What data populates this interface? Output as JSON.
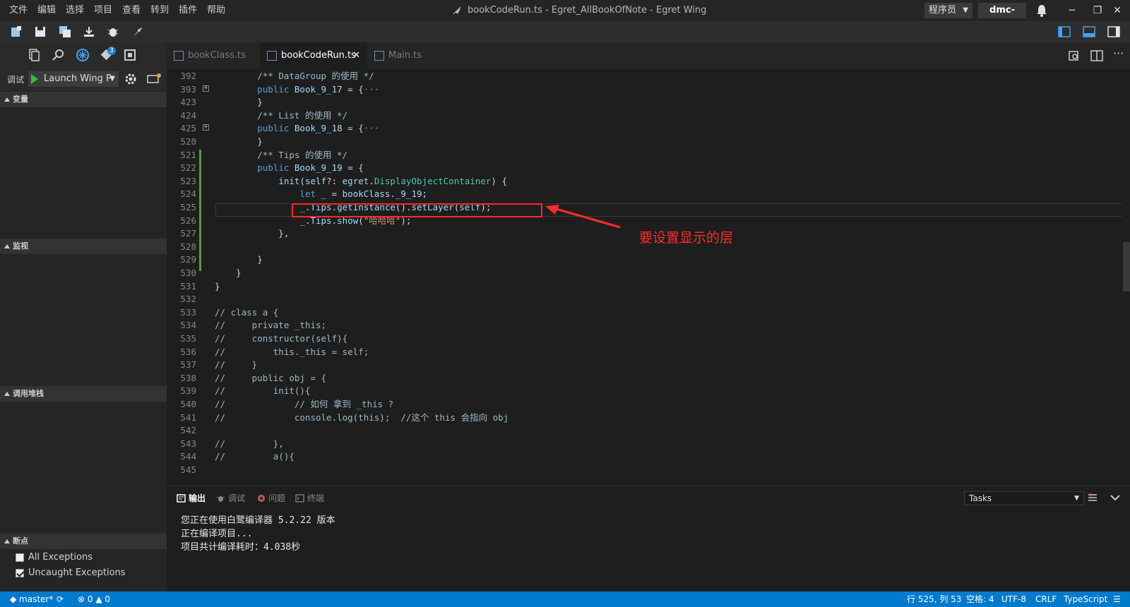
{
  "menu": [
    "文件",
    "编辑",
    "选择",
    "项目",
    "查看",
    "转到",
    "插件",
    "帮助"
  ],
  "window_title": "bookCodeRun.ts - Egret_AllBookOfNote - Egret Wing",
  "role": "程序员",
  "user": "dmc-nero",
  "git_badge": "3",
  "debug": {
    "label": "调试",
    "launch": "Launch Wing P"
  },
  "sections": {
    "variables": "变量",
    "watch": "监视",
    "callstack": "调用堆栈",
    "breakpoints": "断点"
  },
  "breakpoints": [
    {
      "label": "All Exceptions",
      "checked": false
    },
    {
      "label": "Uncaught Exceptions",
      "checked": true
    }
  ],
  "tabs": [
    {
      "label": "bookClass.ts",
      "active": false
    },
    {
      "label": "bookCodeRun.ts",
      "active": true
    },
    {
      "label": "Main.ts",
      "active": false
    }
  ],
  "code_lines": [
    {
      "n": "392",
      "fold": false,
      "html": "        <span class='cm2'>/** DataGroup 的使用 */</span>"
    },
    {
      "n": "393",
      "fold": true,
      "html": "        <span class='kw'>public</span> <span class='id'>Book_9_17</span> = {<span class='gray'>···</span>"
    },
    {
      "n": "423",
      "fold": false,
      "html": "        }"
    },
    {
      "n": "424",
      "fold": false,
      "html": "        <span class='cm2'>/** List 的使用 */</span>"
    },
    {
      "n": "425",
      "fold": true,
      "html": "        <span class='kw'>public</span> <span class='id'>Book_9_18</span> = {<span class='gray'>···</span>"
    },
    {
      "n": "520",
      "fold": false,
      "html": "        }"
    },
    {
      "n": "521",
      "fold": false,
      "html": "        <span class='cm2'>/** Tips 的使用 */</span>"
    },
    {
      "n": "522",
      "fold": false,
      "html": "        <span class='kw'>public</span> <span class='id'>Book_9_19</span> = {"
    },
    {
      "n": "523",
      "fold": false,
      "html": "            <span class='id'>init</span>(<span class='id'>self</span>?: <span class='id'>egret</span>.<span class='ty'>DisplayObjectContainer</span>) {"
    },
    {
      "n": "524",
      "fold": false,
      "html": "                <span class='kw'>let</span> <span class='id'>_</span> = <span class='id'>bookClass</span>.<span class='id'>_9_19</span>;"
    },
    {
      "n": "525",
      "fold": false,
      "html": "                <span class='id'>_</span>.<span class='id'>Tips</span>.<span class='id'>getInstance</span>().<span class='id'>setLayer</span>(<span class='id'>self</span>);"
    },
    {
      "n": "526",
      "fold": false,
      "html": "                <span class='id'>_</span>.<span class='id'>Tips</span>.<span class='id'>show</span>(<span class='str'>\"哈哈哈\"</span>);"
    },
    {
      "n": "527",
      "fold": false,
      "html": "            },"
    },
    {
      "n": "528",
      "fold": false,
      "html": ""
    },
    {
      "n": "529",
      "fold": false,
      "html": "        }"
    },
    {
      "n": "530",
      "fold": false,
      "html": "    }"
    },
    {
      "n": "531",
      "fold": false,
      "html": "}"
    },
    {
      "n": "532",
      "fold": false,
      "html": ""
    },
    {
      "n": "533",
      "fold": false,
      "html": "<span class='cm2'>// class a {</span>"
    },
    {
      "n": "534",
      "fold": false,
      "html": "<span class='cm2'>//     private _this;</span>"
    },
    {
      "n": "535",
      "fold": false,
      "html": "<span class='cm2'>//     constructor(self){</span>"
    },
    {
      "n": "536",
      "fold": false,
      "html": "<span class='cm2'>//         this._this = self;</span>"
    },
    {
      "n": "537",
      "fold": false,
      "html": "<span class='cm2'>//     }</span>"
    },
    {
      "n": "538",
      "fold": false,
      "html": "<span class='cm2'>//     public obj = {</span>"
    },
    {
      "n": "539",
      "fold": false,
      "html": "<span class='cm2'>//         init(){</span>"
    },
    {
      "n": "540",
      "fold": false,
      "html": "<span class='cm2'>//             // 如何 拿到 _this ?</span>"
    },
    {
      "n": "541",
      "fold": false,
      "html": "<span class='cm2'>//             console.log(this);  //这个 this 会指向 obj</span>"
    },
    {
      "n": "542",
      "fold": false,
      "html": ""
    },
    {
      "n": "543",
      "fold": false,
      "html": "<span class='cm2'>//         },</span>"
    },
    {
      "n": "544",
      "fold": false,
      "html": "<span class='cm2'>//         a(){</span>"
    },
    {
      "n": "545",
      "fold": false,
      "html": ""
    }
  ],
  "annotation": "要设置显示的层",
  "panel": {
    "tabs": [
      "输出",
      "调试",
      "问题",
      "终端"
    ],
    "tasks_select": "Tasks",
    "output": [
      "您正在使用白鹭编译器 5.2.22 版本",
      "正在编译项目...",
      "项目共计编译耗时：4.038秒"
    ]
  },
  "status": {
    "branch": "master*",
    "errors": "0",
    "warnings": "0",
    "position": "行 525, 列 53",
    "indent": "空格: 4",
    "encoding": "UTF-8",
    "eol": "CRLF",
    "language": "TypeScript"
  }
}
